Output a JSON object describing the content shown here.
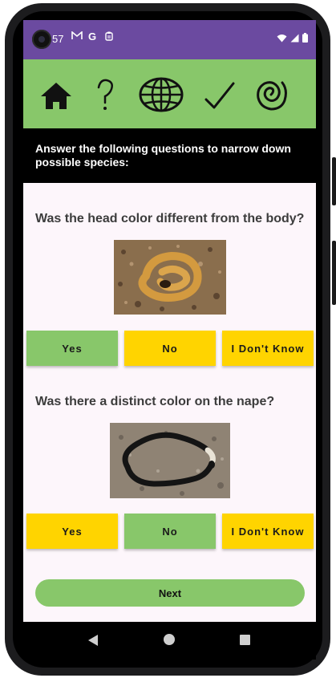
{
  "status_bar": {
    "time": "57",
    "icons": [
      "gmail-icon",
      "google-icon",
      "clipboard-icon"
    ],
    "right_icons": [
      "wifi-icon",
      "cell-signal-icon",
      "battery-icon"
    ]
  },
  "nav": {
    "items": [
      {
        "icon": "home-icon"
      },
      {
        "icon": "help-icon"
      },
      {
        "icon": "globe-icon"
      },
      {
        "icon": "checkmark-icon"
      },
      {
        "icon": "spiral-icon"
      }
    ],
    "color": "#88c76a"
  },
  "banner": {
    "text": "Answer the following questions to narrow down possible species:"
  },
  "questions": [
    {
      "title": "Was the head color different from the body?",
      "answers": {
        "yes": "Yes",
        "no": "No",
        "unknown": "I Don't Know"
      },
      "selected": "yes"
    },
    {
      "title": "Was there a distinct color on the nape?",
      "answers": {
        "yes": "Yes",
        "no": "No",
        "unknown": "I Don't Know"
      },
      "selected": "no"
    }
  ],
  "colors": {
    "selected": "#88c76a",
    "unselected": "#ffd400",
    "status_bar": "#6b4aa0",
    "banner": "#000000"
  },
  "next_button": {
    "label": "Next"
  }
}
